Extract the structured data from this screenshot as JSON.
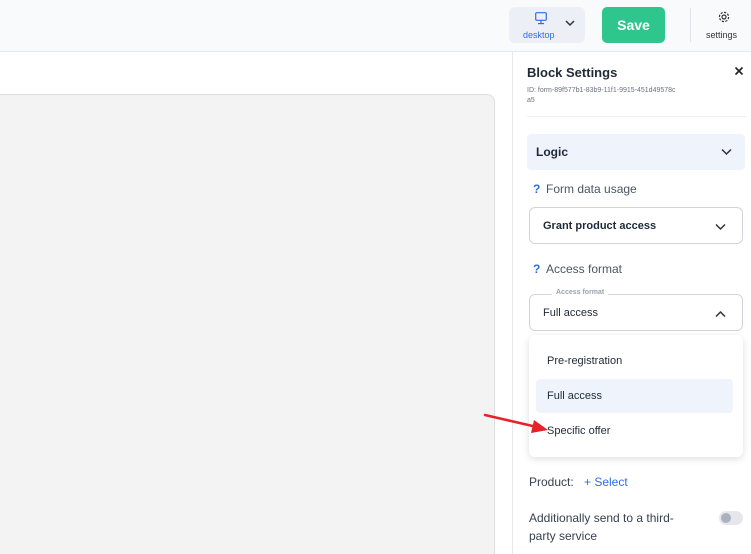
{
  "topbar": {
    "device_label": "desktop",
    "save_label": "Save",
    "settings_label": "settings"
  },
  "panel": {
    "title": "Block Settings",
    "block_id": "ID: form-89f577b1-83b9-11f1-9915-451d49578ca5",
    "section": "Logic",
    "form_data_usage": {
      "label": "Form data usage",
      "value": "Grant product access"
    },
    "access_format": {
      "label": "Access format",
      "floating_label": "Access format",
      "value": "Full access",
      "options": [
        "Pre-registration",
        "Full access",
        "Specific offer"
      ],
      "selected": "Full access"
    },
    "product": {
      "label": "Product:",
      "select_label": "+ Select"
    },
    "third_party": {
      "label": "Additionally send to a third-party service",
      "enabled": false
    }
  },
  "colors": {
    "accent": "#2f6ee3",
    "save": "#2ec68c",
    "annotation_arrow": "#e8212b"
  },
  "icons": [
    "monitor-icon",
    "chevron-down-icon",
    "gear-icon",
    "close-icon",
    "help-icon",
    "chevron-up-icon",
    "annotation-arrow-icon"
  ]
}
